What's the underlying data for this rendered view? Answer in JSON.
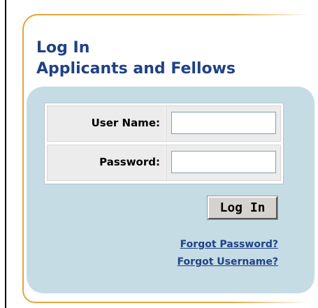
{
  "heading": {
    "line1": "Log In",
    "line2": "Applicants and Fellows"
  },
  "form": {
    "username_label": "User Name:",
    "username_value": "",
    "password_label": "Password:",
    "password_value": "",
    "submit_label": "Log In"
  },
  "links": {
    "forgot_password": "Forgot Password?",
    "forgot_username": "Forgot Username?"
  },
  "colors": {
    "heading": "#1f4286",
    "link": "#1f4286",
    "panel": "#c6dce5",
    "frame": "#e4a53a",
    "button_face": "#d6d3ce"
  }
}
